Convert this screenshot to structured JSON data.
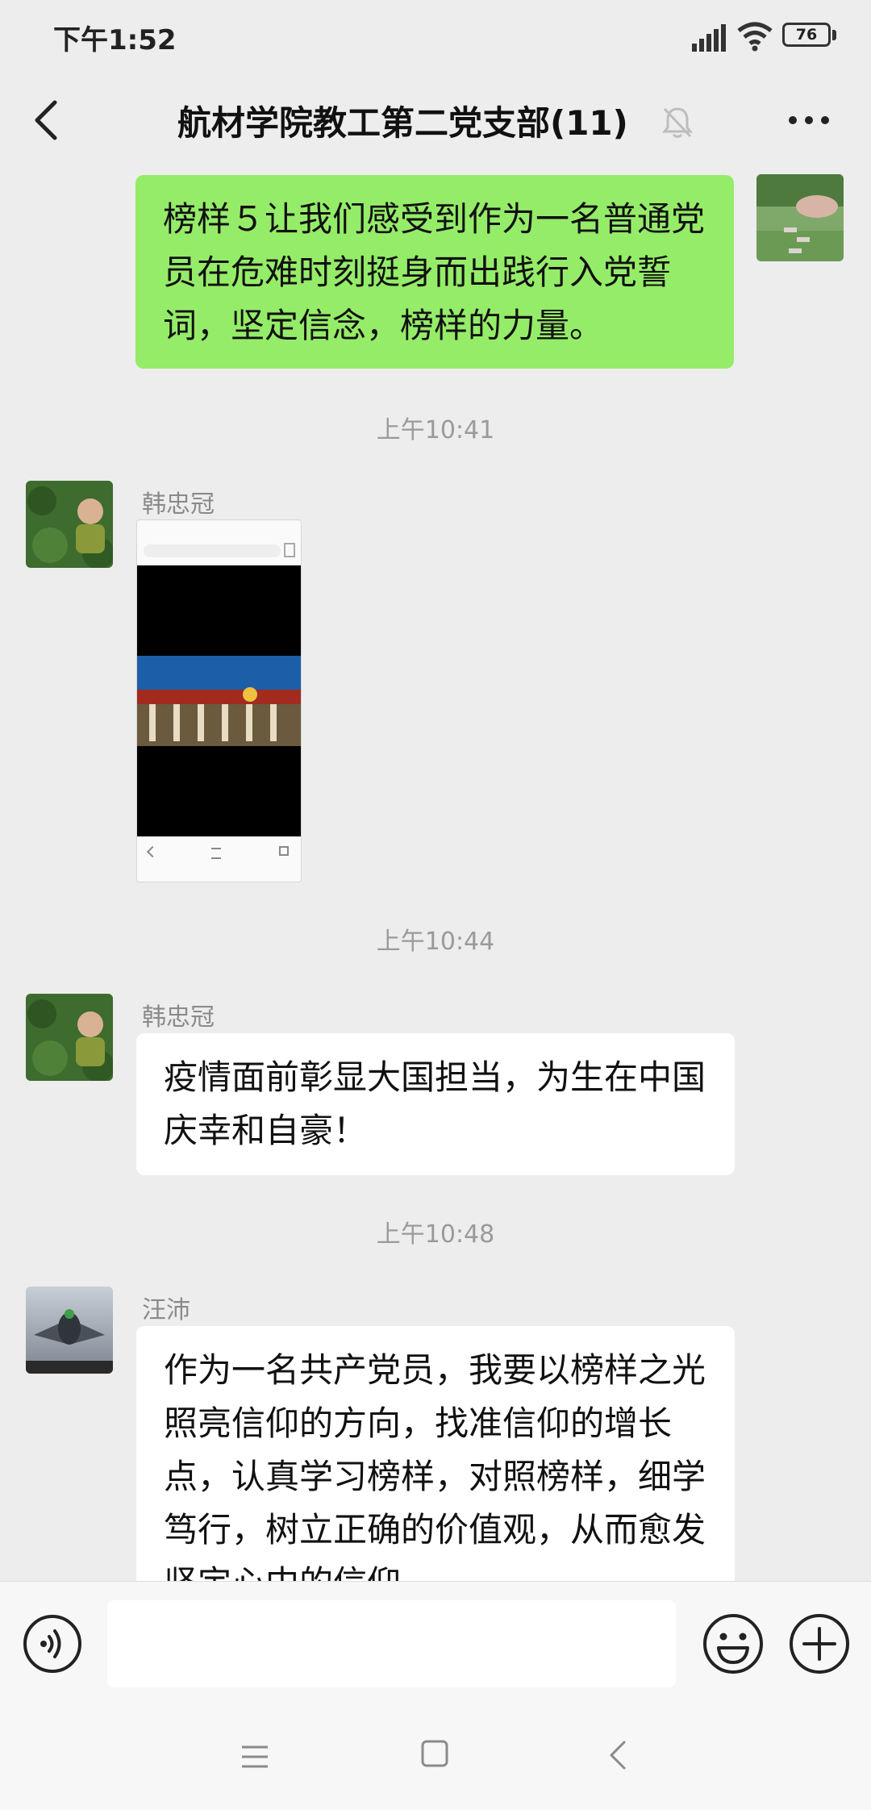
{
  "status_bar": {
    "time": "下午1:52",
    "battery": "76"
  },
  "header": {
    "title": "航材学院教工第二党支部(11)"
  },
  "messages": [
    {
      "type": "text",
      "side": "right",
      "text": "榜样５让我们感受到作为一名普通党员在危难时刻挺身而出践行入党誓词，坚定信念，榜样的力量。"
    },
    {
      "type": "time",
      "text": "上午10:41"
    },
    {
      "type": "image",
      "side": "left",
      "sender": "韩忠冠"
    },
    {
      "type": "time",
      "text": "上午10:44"
    },
    {
      "type": "text",
      "side": "left",
      "sender": "韩忠冠",
      "text": "疫情面前彰显大国担当，为生在中国庆幸和自豪！"
    },
    {
      "type": "time",
      "text": "上午10:48"
    },
    {
      "type": "text",
      "side": "left",
      "sender": "汪沛",
      "text": "作为一名共产党员，我要以榜样之光照亮信仰的方向，找准信仰的增长点，认真学习榜样，对照榜样，细学笃行，树立正确的价值观，从而愈发坚定心中的信仰。"
    }
  ],
  "input": {
    "value": ""
  },
  "colors": {
    "background": "#ededed",
    "bubble_self": "#95ec69",
    "bubble_other": "#ffffff"
  }
}
